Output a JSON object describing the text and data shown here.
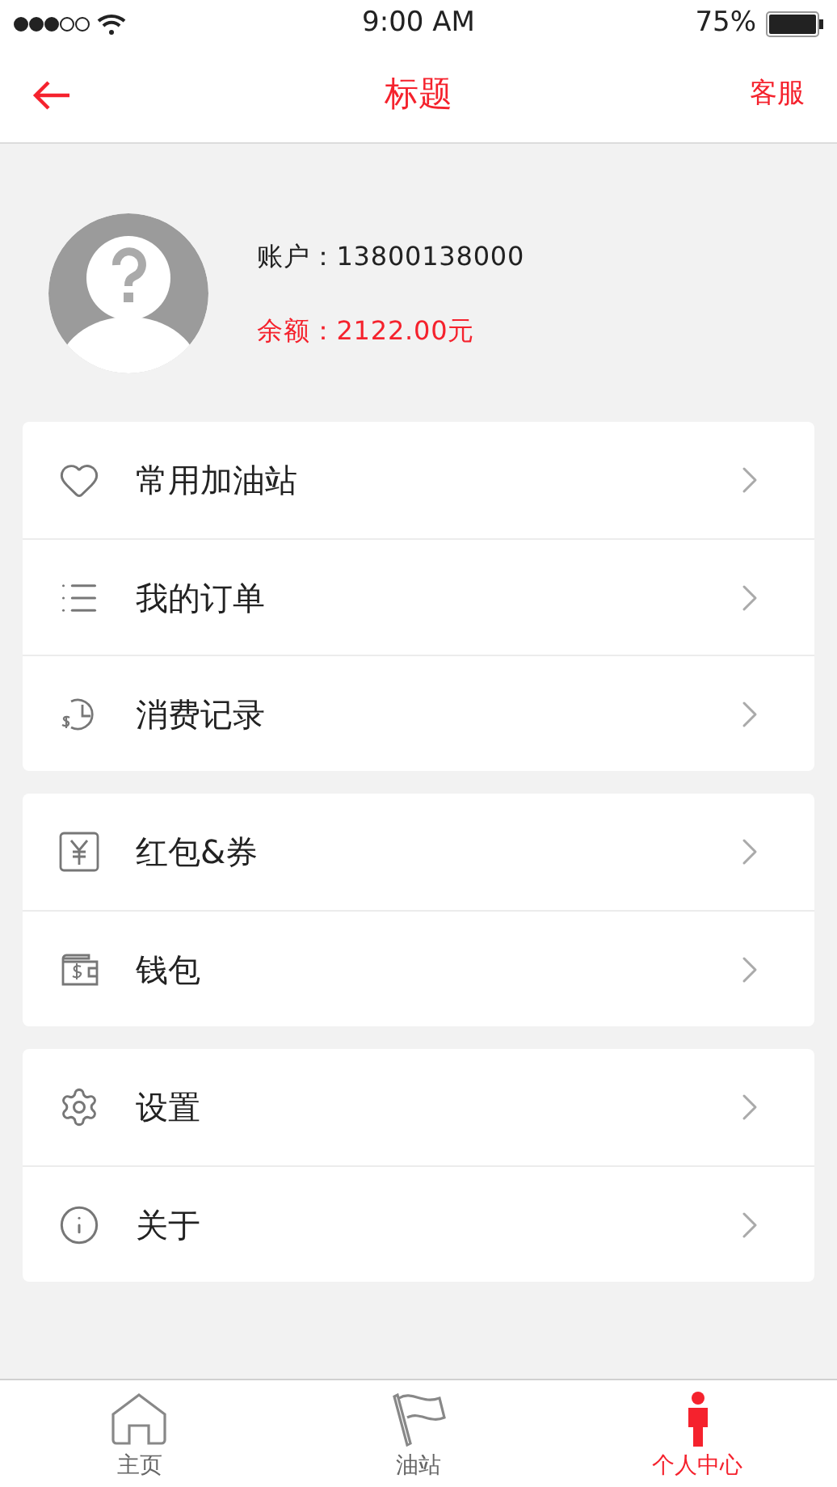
{
  "status_bar": {
    "time": "9:00 AM",
    "battery": "75%"
  },
  "nav": {
    "title": "标题",
    "action": "客服"
  },
  "profile": {
    "account": "账户：13800138000",
    "balance": "余额：2122.00元"
  },
  "groups": [
    {
      "items": [
        {
          "label": "常用加油站"
        },
        {
          "label": "我的订单"
        },
        {
          "label": "消费记录"
        }
      ]
    },
    {
      "items": [
        {
          "label": "红包&券"
        },
        {
          "label": "钱包"
        }
      ]
    },
    {
      "items": [
        {
          "label": "设置"
        },
        {
          "label": "关于"
        }
      ]
    }
  ],
  "tabs": [
    {
      "label": "主页",
      "selected": false
    },
    {
      "label": "油站",
      "selected": false
    },
    {
      "label": "个人中心",
      "selected": true
    }
  ]
}
